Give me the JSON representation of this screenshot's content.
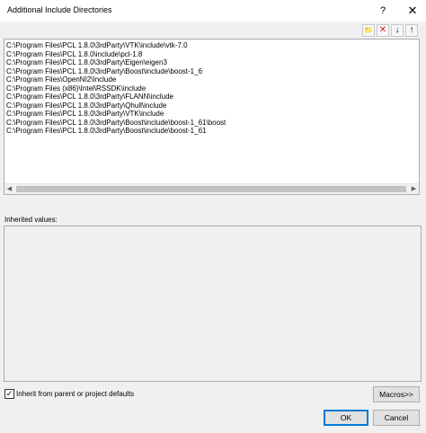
{
  "window": {
    "title": "Additional Include Directories",
    "help_label": "?",
    "close_label": "✕"
  },
  "toolbar": {
    "new_line_icon": "folder-icon",
    "delete_icon": "delete-icon",
    "move_down_icon": "arrow-down-icon",
    "move_up_icon": "arrow-up-icon",
    "new_line_glyph": "📁",
    "delete_glyph": "✕",
    "move_down_glyph": "↓",
    "move_up_glyph": "↑"
  },
  "directories": [
    "C:\\Program Files\\PCL 1.8.0\\3rdParty\\VTK\\include\\vtk-7.0",
    "C:\\Program Files\\PCL 1.8.0\\include\\pcl-1.8",
    "C:\\Program Files\\PCL 1.8.0\\3rdParty\\Eigen\\eigen3",
    "C:\\Program Files\\PCL 1.8.0\\3rdParty\\Boost\\include\\boost-1_6",
    "C:\\Program Files\\OpenNI2\\Include",
    "C:\\Program Files (x86)\\Intel\\RSSDK\\include",
    "C:\\Program Files\\PCL 1.8.0\\3rdParty\\FLANN\\include",
    "C:\\Program Files\\PCL 1.8.0\\3rdParty\\Qhull\\include",
    "C:\\Program Files\\PCL 1.8.0\\3rdParty\\VTK\\include",
    "C:\\Program Files\\PCL 1.8.0\\3rdParty\\Boost\\include\\boost-1_61\\boost",
    "C:\\Program Files\\PCL 1.8.0\\3rdParty\\Boost\\include\\boost-1_61"
  ],
  "inherited": {
    "label": "Inherited values:"
  },
  "inherit_checkbox": {
    "label": "Inherit from parent or project defaults",
    "checked": true,
    "check_glyph": "✓"
  },
  "buttons": {
    "macros": "Macros>>",
    "ok": "OK",
    "cancel": "Cancel"
  },
  "scrollbar": {
    "left_glyph": "◀",
    "right_glyph": "▶"
  }
}
